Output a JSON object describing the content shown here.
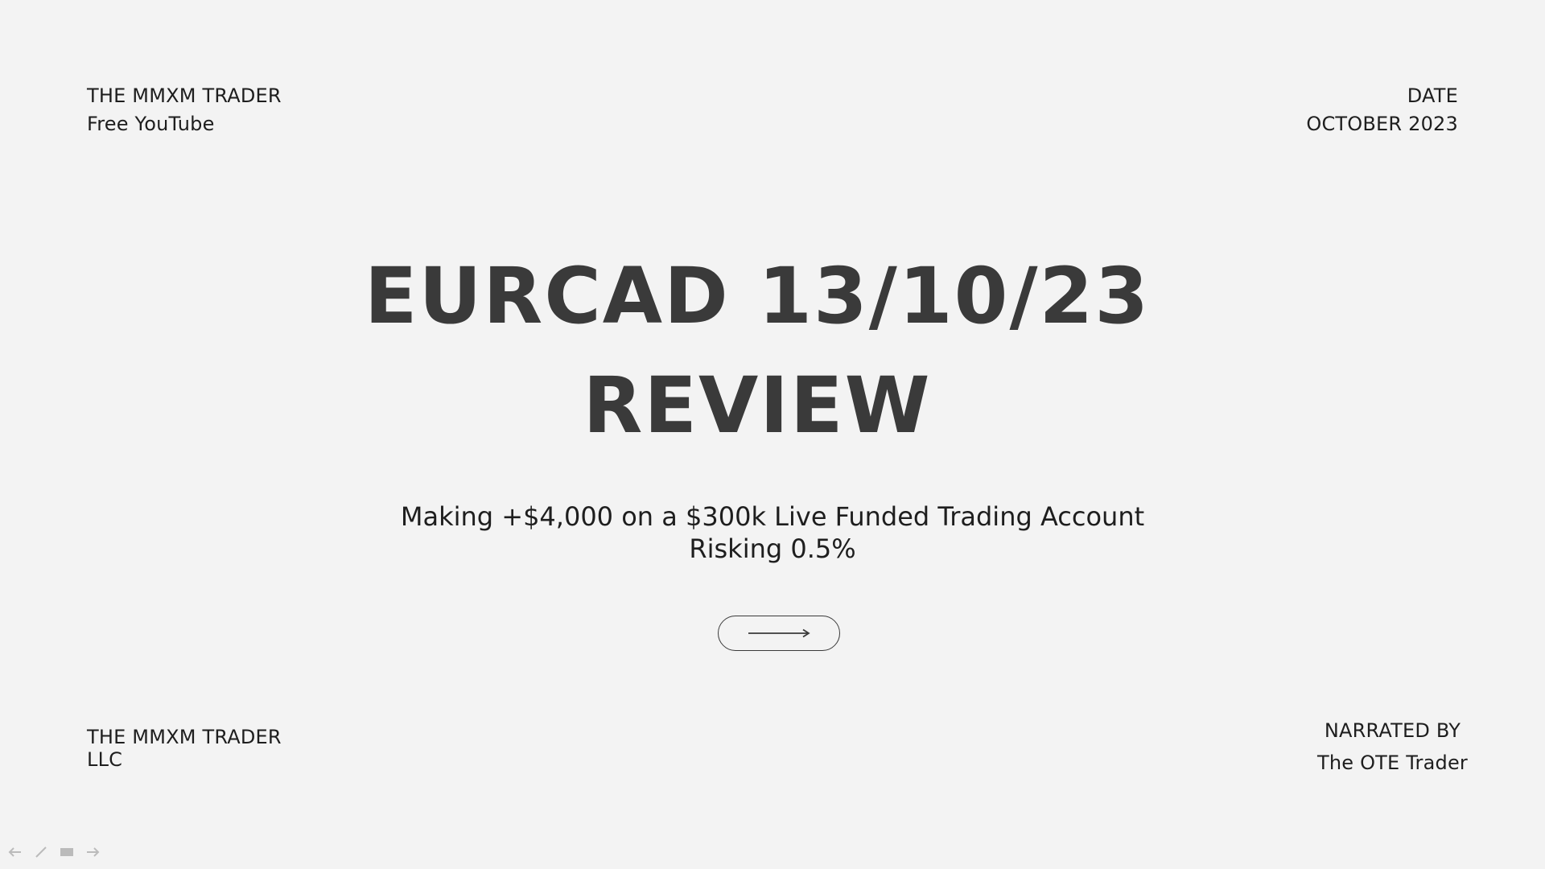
{
  "top_left": {
    "line1": "THE MMXM TRADER",
    "line2": "Free YouTube"
  },
  "top_right": {
    "line1": "DATE",
    "line2": "OCTOBER 2023"
  },
  "title": {
    "line1": "EURCAD 13/10/23",
    "line2": "REVIEW"
  },
  "subtitle": {
    "line1": "Making +$4,000 on a $300k Live Funded Trading Account",
    "line2": "Risking 0.5%"
  },
  "next_button": {
    "icon": "arrow-right-icon"
  },
  "bottom_left": {
    "line1": "THE MMXM TRADER",
    "line2": "LLC"
  },
  "bottom_right": {
    "line1": "NARRATED BY",
    "line2": "The OTE Trader"
  },
  "toolbar": {
    "icons": [
      "back-icon",
      "pen-icon",
      "slides-icon",
      "forward-icon"
    ]
  },
  "colors": {
    "background": "#f3f3f3",
    "title": "#3a3a3a",
    "text": "#1e1e1e"
  }
}
